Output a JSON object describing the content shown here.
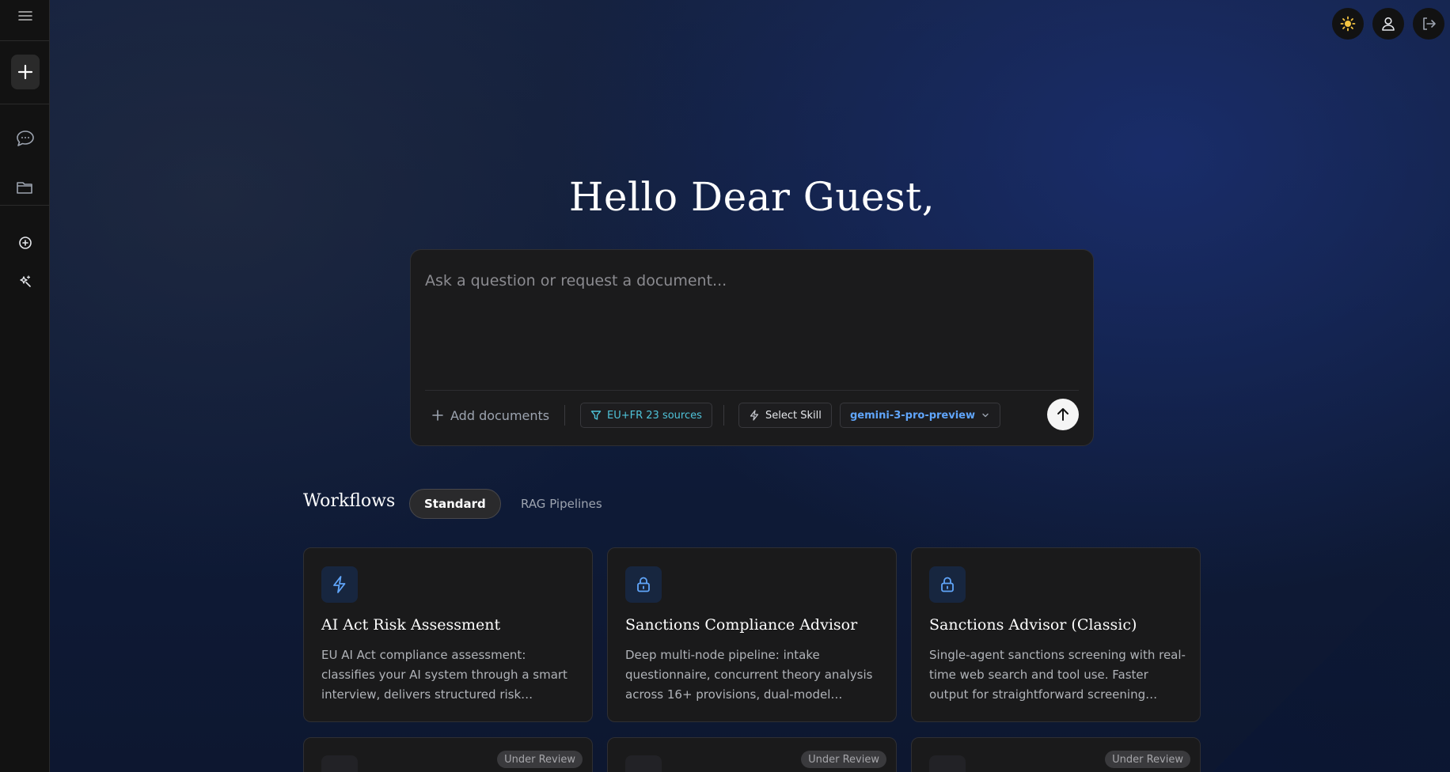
{
  "greeting": "Hello Dear Guest,",
  "prompt": {
    "placeholder": "Ask a question or request a document...",
    "add_documents": "Add documents",
    "sources_chip": "EU+FR 23 sources",
    "skill_chip": "Select Skill",
    "model_chip": "gemini-3-pro-preview"
  },
  "workflows": {
    "title": "Workflows",
    "tabs": [
      {
        "label": "Standard",
        "active": true
      },
      {
        "label": "RAG Pipelines",
        "active": false
      }
    ],
    "cards": [
      {
        "icon": "lightning-icon",
        "title": "AI Act Risk Assessment",
        "description": "EU AI Act compliance assessment: classifies your AI system through a smart interview, delivers structured risk classification, and..."
      },
      {
        "icon": "lock-icon",
        "title": "Sanctions Compliance Advisor",
        "description": "Deep multi-node pipeline: intake questionnaire, concurrent theory analysis across 16+ provisions, dual-model evaluatio..."
      },
      {
        "icon": "lock-icon",
        "title": "Sanctions Advisor (Classic)",
        "description": "Single-agent sanctions screening with real-time web search and tool use. Faster output for straightforward screening questions, qui..."
      }
    ],
    "review_badge": "Under Review"
  },
  "colors": {
    "accent_blue": "#60a5fa",
    "sources_teal": "#4fc3d9",
    "theme_sun": "#f5c542"
  }
}
